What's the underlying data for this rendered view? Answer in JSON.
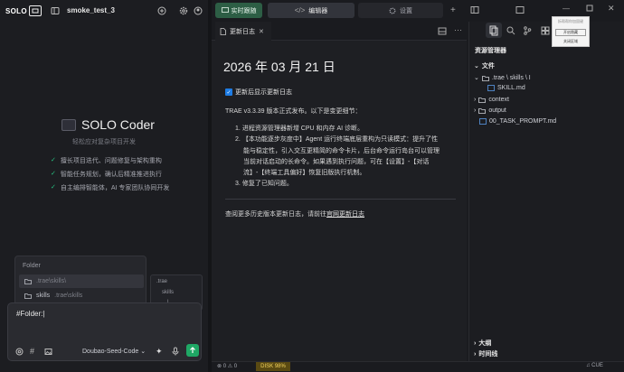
{
  "app": {
    "logo_text": "SOLO",
    "project_name": "smoke_test_3"
  },
  "coder": {
    "title": "SOLO Coder",
    "subtitle": "轻松应对复杂项目开发",
    "features": [
      "擅长项目迭代、问题修复与架构重构",
      "智能任务规划，确认后精准推进执行",
      "自主编排智能体，AI 专家团队协同开发"
    ]
  },
  "folder_popup": {
    "header": "Folder",
    "items": [
      {
        "name": ".trae\\skills\\",
        "path": ""
      },
      {
        "name": "skills",
        "path": ".trae\\skills"
      }
    ],
    "side_items": [
      ".trae",
      "skills",
      "|"
    ]
  },
  "chat": {
    "input_text": "#Folder:|",
    "model": "Doubao-Seed-Code"
  },
  "main_tabs": [
    {
      "label": "实时跟随"
    },
    {
      "label": "编辑器"
    },
    {
      "label": "设置"
    }
  ],
  "editor": {
    "tab_label": "更新日志",
    "date": "2026 年 03 月 21 日",
    "checkbox_label": "更新后显示更新日志",
    "checkbox_checked": true,
    "intro": "TRAE v3.3.39 版本正式发布。以下是变更细节：",
    "list": [
      {
        "num": "1.",
        "lines": [
          "进程资源管理器新增 CPU 和内存 AI 诊断。"
        ]
      },
      {
        "num": "2.",
        "lines": [
          "【本功能逐步灰度中】Agent 运行终端底层重构为只读模式：提升了性",
          "能与稳定性，引入交互更精简的命令卡片，后台命令运行岛台可以管理",
          "当前对话启动的长命令。如果遇到执行问题，可在【设置】-【对话",
          "流】-【终端工具偏好】恢复旧版执行机制。"
        ]
      },
      {
        "num": "3.",
        "lines": [
          "修复了已知问题。"
        ]
      }
    ],
    "footer_text": "查阅更多历史版本更新日志，请前往",
    "footer_link": "官网更新日志"
  },
  "explorer": {
    "title": "资源管理器",
    "section": "文件",
    "tree": [
      {
        "label": ".trae \\ skills \\ I",
        "indent": 0,
        "kind": "folder-open"
      },
      {
        "label": "SKILL.md",
        "indent": 1,
        "kind": "md"
      },
      {
        "label": "context",
        "indent": 0,
        "kind": "folder"
      },
      {
        "label": "output",
        "indent": 0,
        "kind": "folder"
      },
      {
        "label": "00_TASK_PROMPT.md",
        "indent": 0,
        "kind": "md"
      }
    ],
    "outline": "大纲",
    "timeline": "时间线",
    "context_menu": [
      "拆帮帮你加固键",
      "开启隐藏",
      "关闭区域"
    ]
  },
  "statusbar": {
    "errors": "0",
    "warnings": "0",
    "disk": "DISK 98%",
    "encoding": "CUE"
  },
  "colors": {
    "accent_green": "#1fa865",
    "live_tab": "#2d5e45",
    "checkbox": "#1e7ce4",
    "disk_bg": "#5a4a12"
  }
}
